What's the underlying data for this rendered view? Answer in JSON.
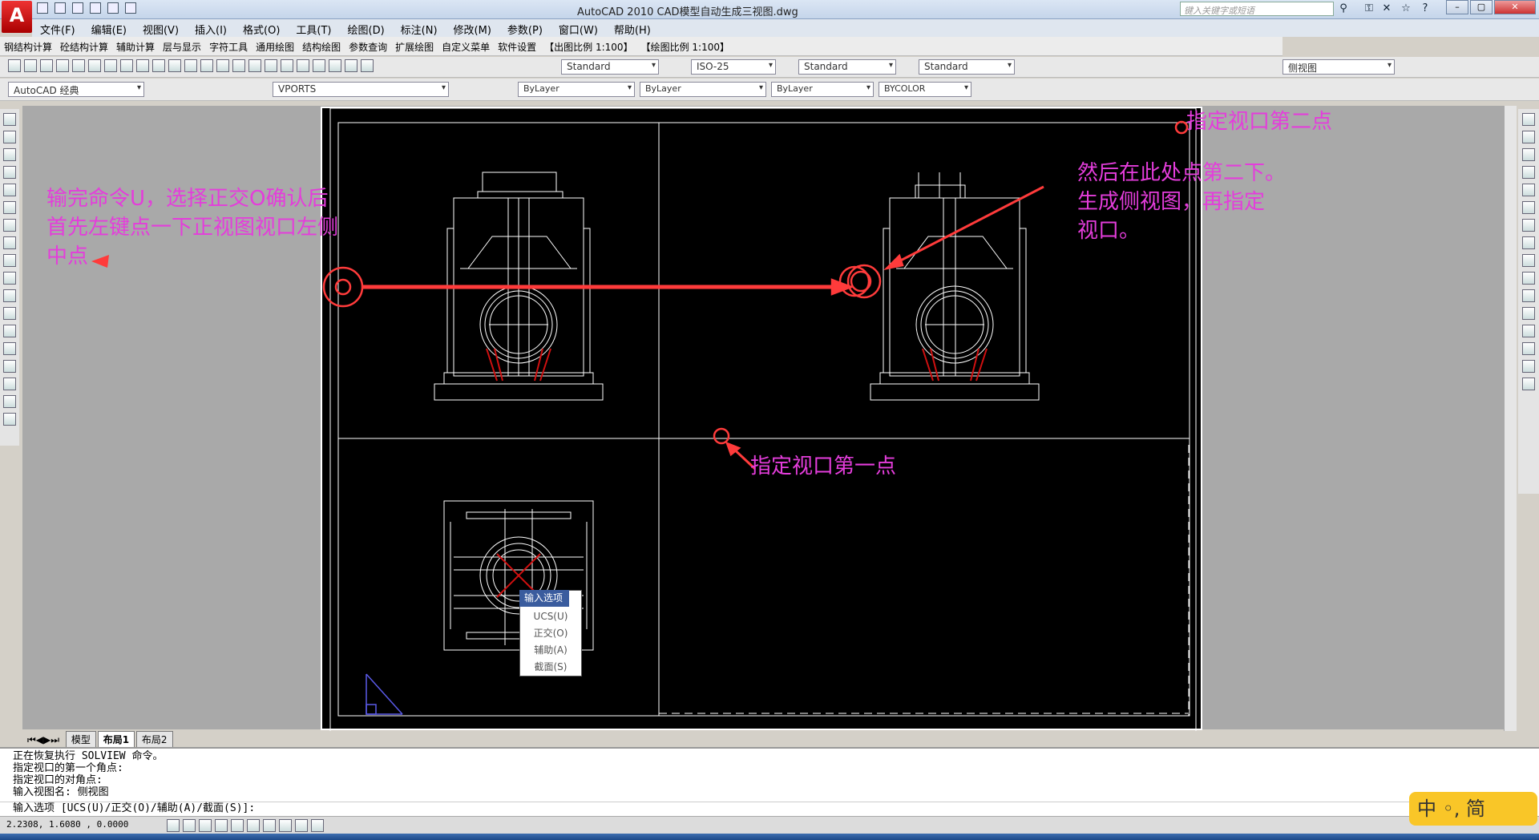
{
  "window": {
    "title": "AutoCAD 2010      CAD模型自动生成三视图.dwg",
    "search_placeholder": "键入关键字或短语",
    "logo_letter": "A"
  },
  "menu": [
    "文件(F)",
    "编辑(E)",
    "视图(V)",
    "插入(I)",
    "格式(O)",
    "工具(T)",
    "绘图(D)",
    "标注(N)",
    "修改(M)",
    "参数(P)",
    "窗口(W)",
    "帮助(H)"
  ],
  "menu2": [
    "钢结构计算",
    "砼结构计算",
    "辅助计算",
    "层与显示",
    "字符工具",
    "通用绘图",
    "结构绘图",
    "参数查询",
    "扩展绘图",
    "自定义菜单",
    "软件设置",
    "【出图比例 1:100】",
    "【绘图比例 1:100】"
  ],
  "toolbar": {
    "text_style": "Standard",
    "dim_style": "ISO-25",
    "table_style": "Standard",
    "mleader_style": "Standard",
    "view_name": "侧视图",
    "workspace": "AutoCAD 经典",
    "layer": "VPORTS",
    "color": "ByLayer",
    "linetype": "ByLayer",
    "lineweight": "ByLayer",
    "plotstyle": "BYCOLOR"
  },
  "annotations": {
    "left": [
      "输完命令U，选择正交O确认后",
      "首先左键点一下正视图视口左侧",
      "中点"
    ],
    "right": [
      "然后在此处点第二下。",
      "生成侧视图，再指定",
      "视口。"
    ],
    "top_right": "指定视口第二点",
    "first_point": "指定视口第一点"
  },
  "context_menu": {
    "header": "输入选项",
    "items": [
      "UCS(U)",
      "正交(O)",
      "辅助(A)",
      "截面(S)"
    ]
  },
  "layout_tabs": [
    "模型",
    "布局1",
    "布局2"
  ],
  "command_history": [
    "正在恢复执行 SOLVIEW 命令。",
    "指定视口的第一个角点:",
    "指定视口的对角点:",
    "输入视图名: 侧视图"
  ],
  "command_prompt": "输入选项 [UCS(U)/正交(O)/辅助(A)/截面(S)]:",
  "status": {
    "coords": "2.2308,    1.6080  , 0.0000"
  },
  "ime": {
    "text": "中 ◦, 简"
  },
  "colors": {
    "annotation": "#e43ddb",
    "arrow": "#ff3b3b",
    "paper": "#000000",
    "drawing_bg": "#a9a9a9"
  }
}
